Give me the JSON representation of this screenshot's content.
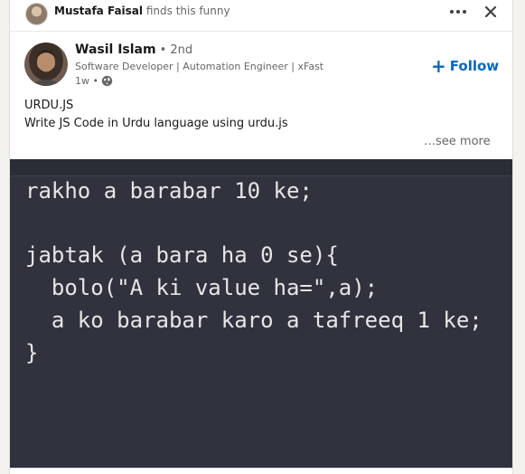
{
  "activity": {
    "actor": "Mustafa Faisal",
    "action": "finds this funny"
  },
  "author": {
    "name": "Wasil Islam",
    "degree": "• 2nd",
    "headline": "Software Developer | Automation Engineer | xFast",
    "time": "1w •"
  },
  "follow_label": "Follow",
  "post": {
    "title": "URDU.JS",
    "body": "Write JS Code in Urdu language using urdu.js",
    "see_more": "…see more"
  },
  "code_lines": [
    "rakho a barabar 10 ke;",
    "",
    "jabtak (a bara ha 0 se){",
    "  bolo(\"A ki value ha=\",a);",
    "  a ko barabar karo a tafreeq 1 ke;",
    "}"
  ],
  "icons": {
    "more": "more-horizontal-icon",
    "close": "close-icon",
    "visibility": "globe-icon",
    "follow": "plus-icon"
  },
  "colors": {
    "accent": "#0a66c2",
    "code_bg": "#30333d",
    "code_text": "#e6e6e6"
  }
}
